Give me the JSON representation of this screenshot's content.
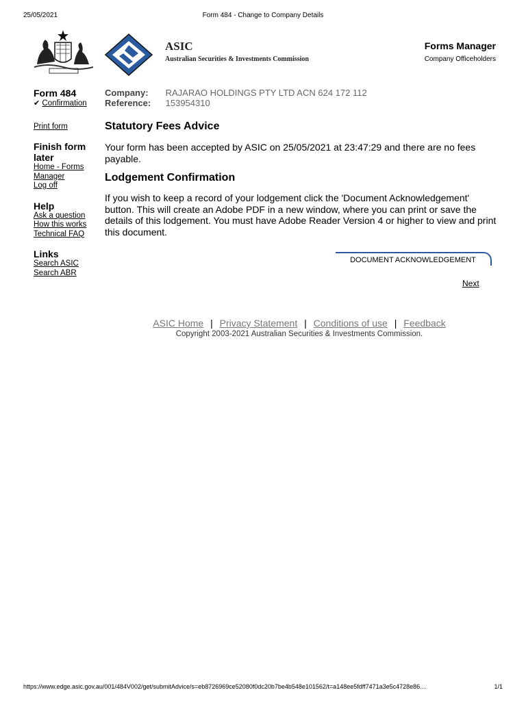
{
  "print_header": {
    "date": "25/05/2021",
    "title": "Form 484 - Change to Company Details"
  },
  "brand": {
    "name": "ASIC",
    "full_name": "Australian Securities & Investments Commission"
  },
  "header_right": {
    "title": "Forms Manager",
    "subtitle": "Company Officeholders"
  },
  "sidebar": {
    "form_heading": "Form 484",
    "confirmation_check": "✔",
    "confirmation_link": "Confirmation",
    "print_form": "Print form",
    "finish_heading": "Finish form later",
    "home_forms_manager": "Home - Forms Manager",
    "log_off": "Log off",
    "help_heading": "Help",
    "ask_question": "Ask a question",
    "how_this_works": "How this works",
    "technical_faq": "Technical FAQ",
    "links_heading": "Links",
    "search_asic": "Search ASIC",
    "search_abr": "Search ABR"
  },
  "main": {
    "company_label": "Company:",
    "company_value": "RAJARAO HOLDINGS PTY LTD ACN 624 172 112",
    "reference_label": "Reference:",
    "reference_value": "153954310",
    "fees_heading": "Statutory Fees Advice",
    "fees_text": "Your form has been accepted by ASIC on 25/05/2021 at 23:47:29 and there are no fees payable.",
    "lodgement_heading": "Lodgement Confirmation",
    "lodgement_text": "If you wish to keep a record of your lodgement click the 'Document Acknowledgement' button. This will create an Adobe PDF in a new window, where you can print or save the details of this lodgement. You must have Adobe Reader Version 4 or higher to view and print this document.",
    "doc_button": "DOCUMENT ACKNOWLEDGEMENT",
    "next_link": "Next"
  },
  "footer": {
    "asic_home": "ASIC Home",
    "privacy": "Privacy Statement",
    "conditions": "Conditions of use",
    "feedback": "Feedback",
    "separator": "|",
    "copyright": "Copyright 2003-2021 Australian Securities & Investments Commission."
  },
  "print_footer": {
    "url": "https://www.edge.asic.gov.au/001/484V002/get/submitAdvice/s=eb8726969ce52080f0dc20b7be4b548e101562/t=a148ee5fdff7471a3e5c4728e86…",
    "page": "1/1"
  },
  "colors": {
    "asic_blue": "#2a5aa0",
    "link_grey": "#777777"
  }
}
